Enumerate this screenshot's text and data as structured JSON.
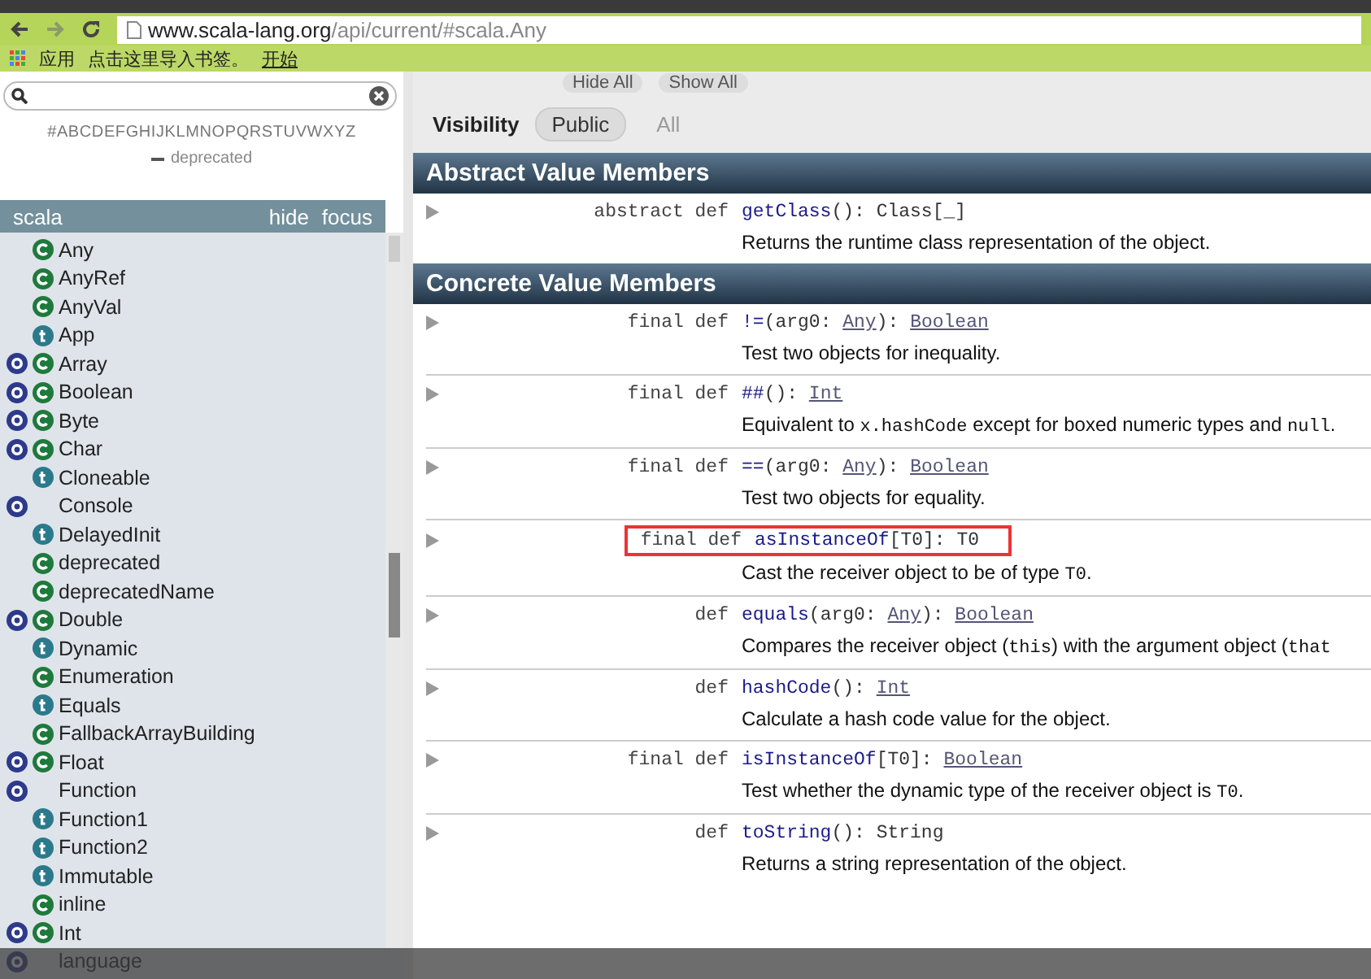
{
  "browser": {
    "url_host": "www.scala-lang.org",
    "url_path": "/api/current/#scala.Any",
    "bookmarks": [
      {
        "label": "应用",
        "kind": "apps"
      },
      {
        "label": "点击这里导入书签。",
        "kind": "text"
      },
      {
        "label": "开始",
        "kind": "link"
      }
    ]
  },
  "sidebar": {
    "letters": "#ABCDEFGHIJKLMNOPQRSTUVWXYZ",
    "deprecated": "deprecated",
    "package": {
      "name": "scala",
      "actions": [
        "hide",
        "focus"
      ]
    },
    "items": [
      {
        "name": "Any",
        "object": false,
        "kind": "class"
      },
      {
        "name": "AnyRef",
        "object": false,
        "kind": "class"
      },
      {
        "name": "AnyVal",
        "object": false,
        "kind": "class"
      },
      {
        "name": "App",
        "object": false,
        "kind": "trait"
      },
      {
        "name": "Array",
        "object": true,
        "kind": "class"
      },
      {
        "name": "Boolean",
        "object": true,
        "kind": "class"
      },
      {
        "name": "Byte",
        "object": true,
        "kind": "class"
      },
      {
        "name": "Char",
        "object": true,
        "kind": "class"
      },
      {
        "name": "Cloneable",
        "object": false,
        "kind": "trait"
      },
      {
        "name": "Console",
        "object": true,
        "kind": "none"
      },
      {
        "name": "DelayedInit",
        "object": false,
        "kind": "trait"
      },
      {
        "name": "deprecated",
        "object": false,
        "kind": "class"
      },
      {
        "name": "deprecatedName",
        "object": false,
        "kind": "class"
      },
      {
        "name": "Double",
        "object": true,
        "kind": "class"
      },
      {
        "name": "Dynamic",
        "object": false,
        "kind": "trait"
      },
      {
        "name": "Enumeration",
        "object": false,
        "kind": "class"
      },
      {
        "name": "Equals",
        "object": false,
        "kind": "trait"
      },
      {
        "name": "FallbackArrayBuilding",
        "object": false,
        "kind": "class"
      },
      {
        "name": "Float",
        "object": true,
        "kind": "class"
      },
      {
        "name": "Function",
        "object": true,
        "kind": "none"
      },
      {
        "name": "Function1",
        "object": false,
        "kind": "trait"
      },
      {
        "name": "Function2",
        "object": false,
        "kind": "trait"
      },
      {
        "name": "Immutable",
        "object": false,
        "kind": "trait"
      },
      {
        "name": "inline",
        "object": false,
        "kind": "class"
      },
      {
        "name": "Int",
        "object": true,
        "kind": "class"
      },
      {
        "name": "language",
        "object": true,
        "kind": "none"
      }
    ]
  },
  "toolbar": {
    "order": [
      "Hide All",
      "Show All"
    ],
    "visibility_label": "Visibility",
    "visibility": [
      {
        "label": "Public",
        "selected": true
      },
      {
        "label": "All",
        "selected": false
      }
    ]
  },
  "sections": [
    {
      "title": "Abstract Value Members",
      "members": [
        {
          "modifiers": "abstract def",
          "highlighted": false,
          "signature": [
            {
              "kind": "name",
              "text": "getClass"
            },
            {
              "kind": "text",
              "text": "(): Class[_]"
            }
          ],
          "comment": [
            {
              "kind": "text",
              "text": "Returns the runtime class representation of the object."
            }
          ]
        }
      ]
    },
    {
      "title": "Concrete Value Members",
      "members": [
        {
          "modifiers": "final def",
          "highlighted": false,
          "signature": [
            {
              "kind": "name",
              "text": "!="
            },
            {
              "kind": "text",
              "text": "(arg0: "
            },
            {
              "kind": "link",
              "text": "Any"
            },
            {
              "kind": "text",
              "text": "): "
            },
            {
              "kind": "link",
              "text": "Boolean"
            }
          ],
          "comment": [
            {
              "kind": "text",
              "text": "Test two objects for inequality."
            }
          ]
        },
        {
          "modifiers": "final def",
          "highlighted": false,
          "signature": [
            {
              "kind": "name",
              "text": "##"
            },
            {
              "kind": "text",
              "text": "(): "
            },
            {
              "kind": "link",
              "text": "Int"
            }
          ],
          "comment": [
            {
              "kind": "text",
              "text": "Equivalent to "
            },
            {
              "kind": "code",
              "text": "x.hashCode"
            },
            {
              "kind": "text",
              "text": " except for boxed numeric types and "
            },
            {
              "kind": "code",
              "text": "null"
            },
            {
              "kind": "text",
              "text": "."
            }
          ]
        },
        {
          "modifiers": "final def",
          "highlighted": false,
          "signature": [
            {
              "kind": "name",
              "text": "=="
            },
            {
              "kind": "text",
              "text": "(arg0: "
            },
            {
              "kind": "link",
              "text": "Any"
            },
            {
              "kind": "text",
              "text": "): "
            },
            {
              "kind": "link",
              "text": "Boolean"
            }
          ],
          "comment": [
            {
              "kind": "text",
              "text": "Test two objects for equality."
            }
          ]
        },
        {
          "modifiers": "final def",
          "highlighted": true,
          "signature": [
            {
              "kind": "name",
              "text": "asInstanceOf"
            },
            {
              "kind": "text",
              "text": "[T0]: T0"
            }
          ],
          "comment": [
            {
              "kind": "text",
              "text": "Cast the receiver object to be of type "
            },
            {
              "kind": "code",
              "text": "T0"
            },
            {
              "kind": "text",
              "text": "."
            }
          ]
        },
        {
          "modifiers": "def",
          "highlighted": false,
          "signature": [
            {
              "kind": "name",
              "text": "equals"
            },
            {
              "kind": "text",
              "text": "(arg0: "
            },
            {
              "kind": "link",
              "text": "Any"
            },
            {
              "kind": "text",
              "text": "): "
            },
            {
              "kind": "link",
              "text": "Boolean"
            }
          ],
          "comment": [
            {
              "kind": "text",
              "text": "Compares the receiver object ("
            },
            {
              "kind": "code",
              "text": "this"
            },
            {
              "kind": "text",
              "text": ") with the argument object ("
            },
            {
              "kind": "code",
              "text": "that"
            }
          ]
        },
        {
          "modifiers": "def",
          "highlighted": false,
          "signature": [
            {
              "kind": "name",
              "text": "hashCode"
            },
            {
              "kind": "text",
              "text": "(): "
            },
            {
              "kind": "link",
              "text": "Int"
            }
          ],
          "comment": [
            {
              "kind": "text",
              "text": "Calculate a hash code value for the object."
            }
          ]
        },
        {
          "modifiers": "final def",
          "highlighted": false,
          "signature": [
            {
              "kind": "name",
              "text": "isInstanceOf"
            },
            {
              "kind": "text",
              "text": "[T0]: "
            },
            {
              "kind": "link",
              "text": "Boolean"
            }
          ],
          "comment": [
            {
              "kind": "text",
              "text": "Test whether the dynamic type of the receiver object is "
            },
            {
              "kind": "code",
              "text": "T0"
            },
            {
              "kind": "text",
              "text": "."
            }
          ]
        },
        {
          "modifiers": "def",
          "highlighted": false,
          "signature": [
            {
              "kind": "name",
              "text": "toString"
            },
            {
              "kind": "text",
              "text": "(): String"
            }
          ],
          "comment": [
            {
              "kind": "text",
              "text": "Returns a string representation of the object."
            }
          ]
        }
      ]
    }
  ]
}
